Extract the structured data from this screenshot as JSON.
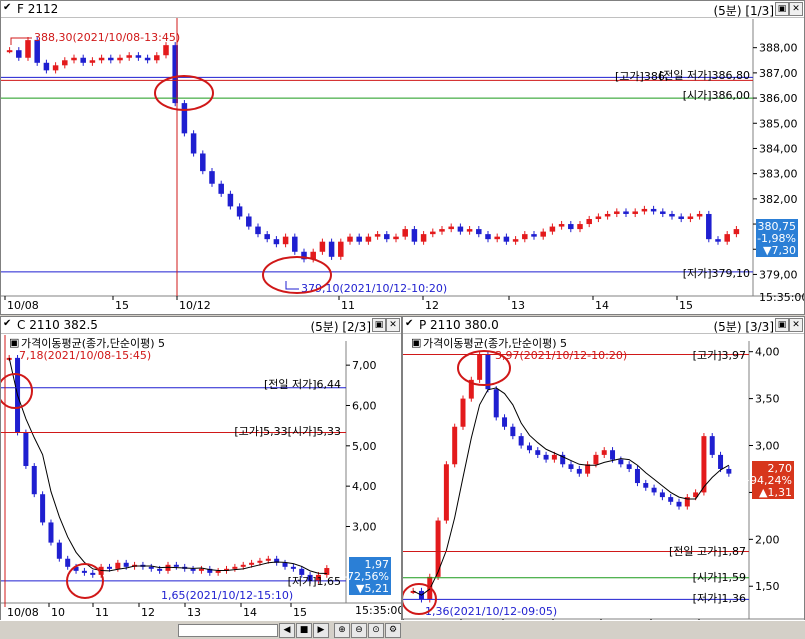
{
  "top": {
    "title": "F 2112",
    "period": "(5분) [1/3]",
    "y_ticks": [
      "388,00",
      "387,00",
      "386,00",
      "385,00",
      "384,00",
      "383,00",
      "382,00",
      "381,00",
      "380,00",
      "379,00"
    ],
    "x_ticks": [
      "10/08",
      "15",
      "10/12",
      "11",
      "12",
      "13",
      "14",
      "15",
      "15:35:00"
    ],
    "annotations": {
      "high_note": "388,30(2021/10/08-13:45)",
      "low_note": "379,10(2021/10/12-10:20)",
      "prev_low": "[전일 저가]386,80",
      "high_label": "[고가]386,",
      "open_label": "[시가]386,00",
      "low_label": "[저가]379,10"
    },
    "price_box": {
      "price": "380,75",
      "pct": "-1,98%",
      "chg": "▼7,30"
    }
  },
  "call": {
    "title": "C 2110 382.5",
    "period": "(5분) [2/3]",
    "indicator": "가격이동평균(종가,단순이평) 5",
    "y_ticks": [
      "7,00",
      "6,00",
      "5,00",
      "4,00",
      "3,00"
    ],
    "x_ticks": [
      "10/08",
      "10",
      "11",
      "12",
      "13",
      "14",
      "15",
      "15:35:00"
    ],
    "annotations": {
      "high_note": "7,18(2021/10/08-15:45)",
      "low_note": "1,65(2021/10/12-15:10)",
      "prev_low": "[전일 저가]6,44",
      "high_open": "[고가]5,33[시가]5,33",
      "low_label": "[저가]1,65"
    },
    "price_box": {
      "price": "1,97",
      "pct": "-72,56%",
      "chg": "▼5,21"
    }
  },
  "put": {
    "title": "P 2110 380.0",
    "period": "(5분) [3/3]",
    "indicator": "가격이동평균(종가,단순이평) 5",
    "y_ticks": [
      "4,00",
      "3,50",
      "3,00",
      "2,50",
      "2,00",
      "1,50"
    ],
    "x_ticks": [
      "10/08",
      "10",
      "11",
      "12",
      "13",
      "14",
      "15",
      "15:35:00"
    ],
    "annotations": {
      "high_note": "3,97(2021/10/12-10:20)",
      "low_note": "1,36(2021/10/12-09:05)",
      "high_label": "[고가]3,97",
      "prev_high": "[전일 고가]1,87",
      "open_label": "[시가]1,59",
      "low_label": "[저가]1,36"
    },
    "price_box": {
      "price": "2,70",
      "pct": "+94,24%",
      "chg": "▲1,31"
    }
  },
  "colors": {
    "up": "#e31a1c",
    "down": "#1f1fd0",
    "accent_blue": "#2b7fd6",
    "accent_red": "#d7361c",
    "marker": "#d01818"
  },
  "chart_data": [
    {
      "type": "candlestick",
      "title": "F 2112",
      "ylim": [
        378.7,
        388.9
      ],
      "x_ticks": [
        "10/08",
        "15",
        "10/12",
        "11",
        "12",
        "13",
        "14",
        "15"
      ],
      "series": [
        {
          "values": [
            387.9,
            387.6,
            388.3,
            387.4,
            387.1,
            387.3,
            387.5,
            387.6,
            387.4,
            387.5,
            387.6,
            387.5,
            387.6,
            387.7,
            387.6,
            387.5,
            387.7,
            388.1,
            385.8,
            384.6,
            383.8,
            383.1,
            382.6,
            382.2,
            381.7,
            381.3,
            380.9,
            380.6,
            380.4,
            380.2,
            380.5,
            379.9,
            379.6,
            379.9,
            380.3,
            379.7,
            380.3,
            380.5,
            380.3,
            380.5,
            380.6,
            380.4,
            380.5,
            380.8,
            380.3,
            380.6,
            380.7,
            380.8,
            380.9,
            380.7,
            380.8,
            380.6,
            380.4,
            380.5,
            380.3,
            380.4,
            380.6,
            380.5,
            380.7,
            380.9,
            381.0,
            380.8,
            381.0,
            381.2,
            381.3,
            381.4,
            381.5,
            381.4,
            381.5,
            381.6,
            381.5,
            381.4,
            381.3,
            381.2,
            381.3,
            381.4,
            380.4,
            380.3,
            380.6,
            380.8
          ]
        }
      ]
    },
    {
      "type": "candlestick",
      "title": "C 2110 382.5",
      "ylim": [
        1.45,
        7.45
      ],
      "series": [
        {
          "name": "가격이동평균(종가,단순이평) 5",
          "values": [
            7.18,
            5.33,
            4.5,
            3.8,
            3.1,
            2.6,
            2.2,
            2.0,
            1.9,
            1.85,
            1.8,
            2.0,
            1.95,
            2.1,
            2.0,
            2.05,
            2.0,
            1.95,
            1.9,
            2.05,
            2.0,
            1.95,
            1.9,
            1.95,
            1.85,
            1.9,
            1.95,
            2.0,
            2.05,
            2.1,
            2.15,
            2.2,
            2.1,
            2.0,
            1.95,
            1.8,
            1.65,
            1.8,
            1.97
          ]
        }
      ]
    },
    {
      "type": "candlestick",
      "title": "P 2110 380.0",
      "ylim": [
        1.3,
        4.05
      ],
      "series": [
        {
          "name": "가격이동평균(종가,단순이평) 5",
          "values": [
            1.45,
            1.36,
            1.6,
            2.2,
            2.8,
            3.2,
            3.5,
            3.7,
            3.97,
            3.6,
            3.3,
            3.2,
            3.1,
            3.0,
            2.95,
            2.9,
            2.85,
            2.9,
            2.8,
            2.75,
            2.7,
            2.8,
            2.9,
            2.95,
            2.85,
            2.8,
            2.75,
            2.6,
            2.55,
            2.5,
            2.45,
            2.4,
            2.35,
            2.45,
            2.5,
            3.1,
            2.9,
            2.75,
            2.7
          ]
        }
      ]
    }
  ]
}
